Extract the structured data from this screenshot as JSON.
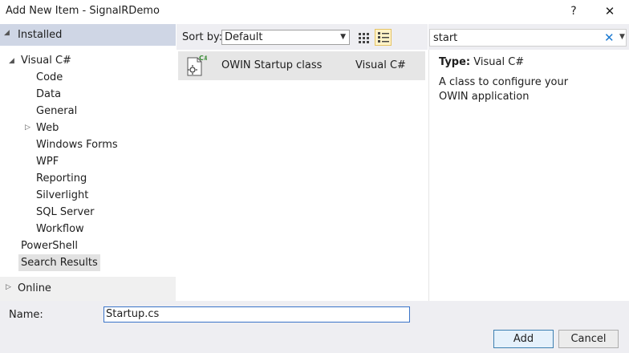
{
  "window": {
    "title": "Add New Item - SignalRDemo",
    "help_glyph": "?",
    "close_glyph": "✕"
  },
  "left": {
    "installed": "Installed",
    "tree": [
      {
        "label": "Visual C#",
        "name": "tree-visual-csharp"
      },
      {
        "label": "Code",
        "name": "tree-code"
      },
      {
        "label": "Data",
        "name": "tree-data"
      },
      {
        "label": "General",
        "name": "tree-general"
      },
      {
        "label": "Web",
        "name": "tree-web"
      },
      {
        "label": "Windows Forms",
        "name": "tree-windows-forms"
      },
      {
        "label": "WPF",
        "name": "tree-wpf"
      },
      {
        "label": "Reporting",
        "name": "tree-reporting"
      },
      {
        "label": "Silverlight",
        "name": "tree-silverlight"
      },
      {
        "label": "SQL Server",
        "name": "tree-sql-server"
      },
      {
        "label": "Workflow",
        "name": "tree-workflow"
      },
      {
        "label": "PowerShell",
        "name": "tree-powershell"
      },
      {
        "label": "Search Results",
        "name": "tree-search-results"
      }
    ],
    "online": "Online"
  },
  "toolbar": {
    "sort_label": "Sort by:",
    "sort_value": "Default"
  },
  "items": [
    {
      "name": "OWIN Startup class",
      "language": "Visual C#"
    }
  ],
  "search": {
    "value": "start"
  },
  "details": {
    "type_label": "Type:",
    "type_value": "Visual C#",
    "description": "A class to configure your OWIN application"
  },
  "bottom": {
    "name_label": "Name:",
    "name_value": "Startup.cs",
    "add_label": "Add",
    "cancel_label": "Cancel"
  },
  "colors": {
    "accent": "#3a74c8",
    "installed_header": "#cfd6e5",
    "selected_row": "#e6e6e6"
  }
}
